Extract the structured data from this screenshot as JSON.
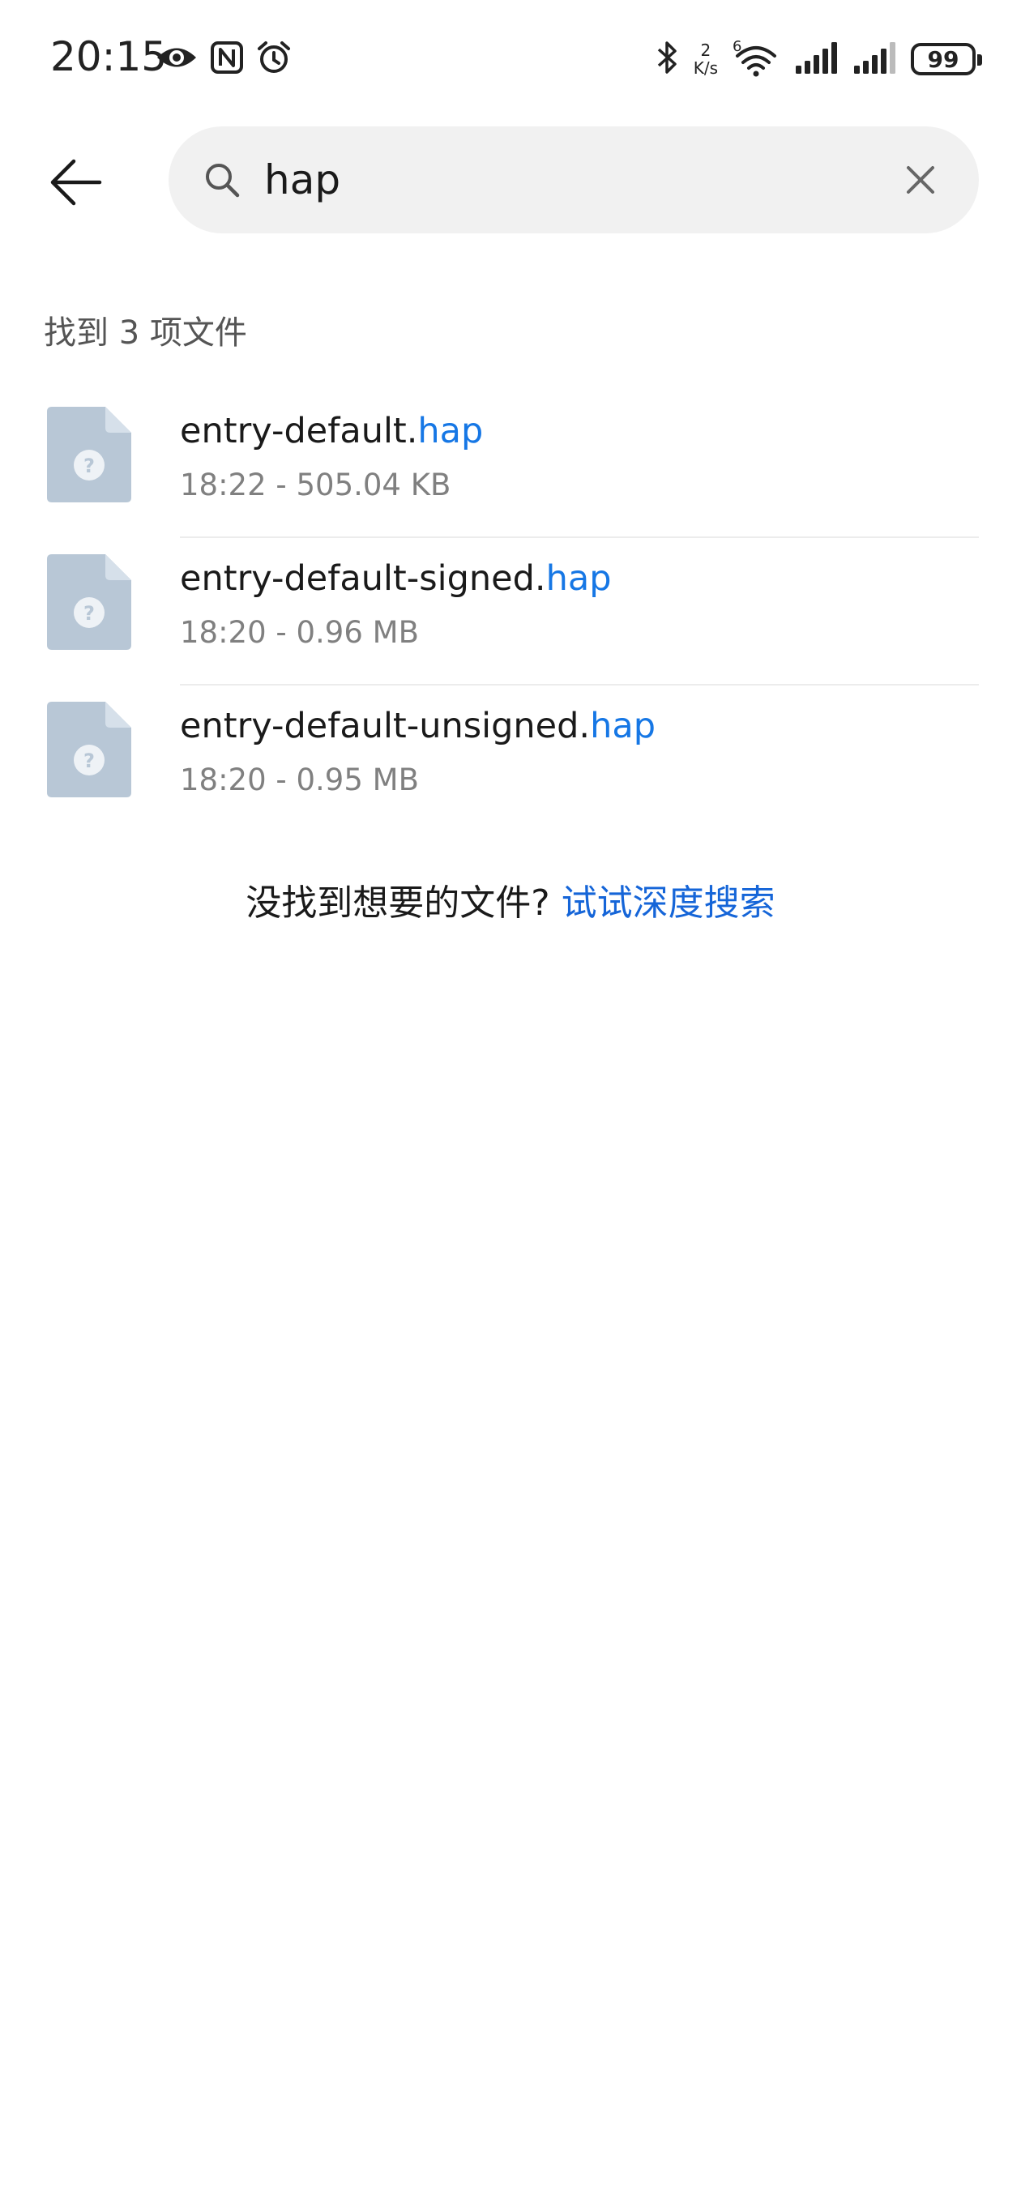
{
  "status_bar": {
    "time": "20:15",
    "net_speed_value": "2",
    "net_speed_unit": "K/s",
    "wifi_badge": "6",
    "battery": "99",
    "icons": [
      "eye-icon",
      "nfc-icon",
      "alarm-icon",
      "bluetooth-icon",
      "wifi-icon",
      "signal-icon",
      "signal-icon-2",
      "battery-icon"
    ]
  },
  "search": {
    "query": "hap",
    "placeholder": ""
  },
  "results": {
    "count_label": "找到 3 项文件",
    "files": [
      {
        "name_prefix": "entry-default.",
        "name_match": "hap",
        "meta": "18:22 - 505.04 KB"
      },
      {
        "name_prefix": "entry-default-signed.",
        "name_match": "hap",
        "meta": "18:20 - 0.96 MB"
      },
      {
        "name_prefix": "entry-default-unsigned.",
        "name_match": "hap",
        "meta": "18:20 - 0.95 MB"
      }
    ]
  },
  "deep_search": {
    "prompt": "没找到想要的文件?",
    "link": "试试深度搜索"
  },
  "colors": {
    "highlight": "#1677e5",
    "link": "#1565d8",
    "file_icon": "#b8c7d6"
  }
}
